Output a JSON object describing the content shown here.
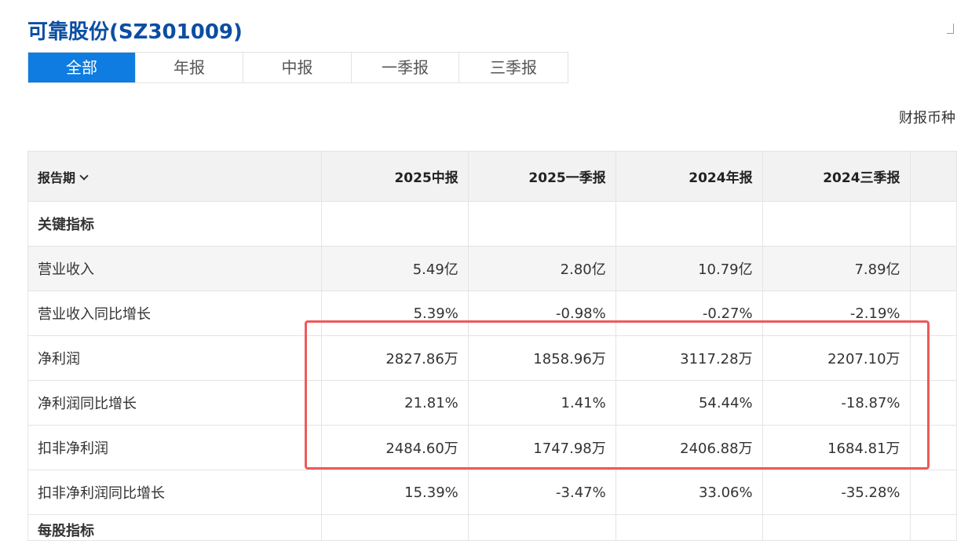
{
  "page": {
    "title": "可靠股份(SZ301009)",
    "currency_label": "财报币种"
  },
  "tabs": [
    {
      "label": "全部",
      "active": true
    },
    {
      "label": "年报",
      "active": false
    },
    {
      "label": "中报",
      "active": false
    },
    {
      "label": "一季报",
      "active": false
    },
    {
      "label": "三季报",
      "active": false
    }
  ],
  "table": {
    "header_label": "报告期",
    "periods": [
      "2025中报",
      "2025一季报",
      "2024年报",
      "2024三季报"
    ],
    "rows": [
      {
        "label": "关键指标",
        "section": true,
        "values": [
          "",
          "",
          "",
          ""
        ]
      },
      {
        "label": "营业收入",
        "values": [
          "5.49亿",
          "2.80亿",
          "10.79亿",
          "7.89亿"
        ]
      },
      {
        "label": "营业收入同比增长",
        "values": [
          "5.39%",
          "-0.98%",
          "-0.27%",
          "-2.19%"
        ]
      },
      {
        "label": "净利润",
        "values": [
          "2827.86万",
          "1858.96万",
          "3117.28万",
          "2207.10万"
        ]
      },
      {
        "label": "净利润同比增长",
        "values": [
          "21.81%",
          "1.41%",
          "54.44%",
          "-18.87%"
        ]
      },
      {
        "label": "扣非净利润",
        "values": [
          "2484.60万",
          "1747.98万",
          "2406.88万",
          "1684.81万"
        ]
      },
      {
        "label": "扣非净利润同比增长",
        "values": [
          "15.39%",
          "-3.47%",
          "33.06%",
          "-35.28%"
        ]
      },
      {
        "label": "每股指标",
        "section": true,
        "values": [
          "",
          "",
          "",
          ""
        ]
      }
    ]
  },
  "colors": {
    "title": "#0b4ea2",
    "tab_active_bg": "#0e7ce0",
    "highlight_border": "#ee5a5a"
  }
}
